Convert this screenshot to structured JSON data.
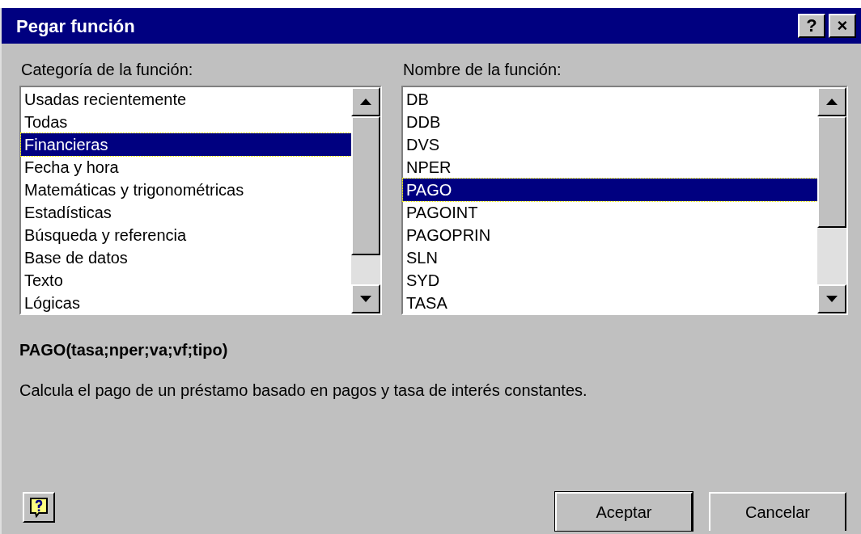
{
  "window": {
    "title": "Pegar función",
    "title_buttons": [
      "?",
      "×"
    ]
  },
  "category_list": {
    "label": "Categoría de la función:",
    "items": [
      {
        "label": "Usadas recientemente",
        "selected": false
      },
      {
        "label": "Todas",
        "selected": false
      },
      {
        "label": "Financieras",
        "selected": true
      },
      {
        "label": "Fecha y hora",
        "selected": false
      },
      {
        "label": "Matemáticas y trigonométricas",
        "selected": false
      },
      {
        "label": "Estadísticas",
        "selected": false
      },
      {
        "label": "Búsqueda y referencia",
        "selected": false
      },
      {
        "label": "Base de datos",
        "selected": false
      },
      {
        "label": "Texto",
        "selected": false
      },
      {
        "label": "Lógicas",
        "selected": false
      }
    ]
  },
  "function_list": {
    "label": "Nombre de la función:",
    "items": [
      {
        "label": "DB",
        "selected": false
      },
      {
        "label": "DDB",
        "selected": false
      },
      {
        "label": "DVS",
        "selected": false
      },
      {
        "label": "NPER",
        "selected": false
      },
      {
        "label": "PAGO",
        "selected": true
      },
      {
        "label": "PAGOINT",
        "selected": false
      },
      {
        "label": "PAGOPRIN",
        "selected": false
      },
      {
        "label": "SLN",
        "selected": false
      },
      {
        "label": "SYD",
        "selected": false
      },
      {
        "label": "TASA",
        "selected": false
      }
    ]
  },
  "signature": "PAGO(tasa;nper;va;vf;tipo)",
  "description": "Calcula el pago de un préstamo basado en pagos y tasa de interés constantes.",
  "buttons": [
    "Aceptar",
    "Cancelar"
  ]
}
